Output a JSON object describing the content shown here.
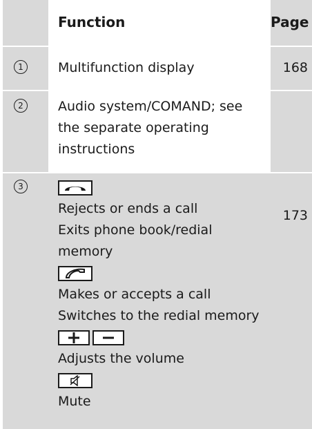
{
  "header": {
    "col_function": "Function",
    "col_page": "Page"
  },
  "rows": [
    {
      "marker": "1",
      "function": "Multifunction display",
      "page": "168"
    },
    {
      "marker": "2",
      "function": "Audio system/COMAND; see the separate operating instructions",
      "page": ""
    },
    {
      "marker": "3",
      "page": "173",
      "entries": [
        "Rejects or ends a call",
        "Exits phone book/redial memory",
        "Makes or accepts a call",
        "Switches to the redial memory",
        "Adjusts the volume",
        "Mute"
      ],
      "keys": [
        "end-call-key-icon",
        "accept-call-key-icon",
        "volume-plus-key-icon",
        "volume-minus-key-icon",
        "mute-key-icon"
      ]
    }
  ],
  "colors": {
    "gray": "#d9d9d9",
    "text": "#1a1a1a"
  }
}
